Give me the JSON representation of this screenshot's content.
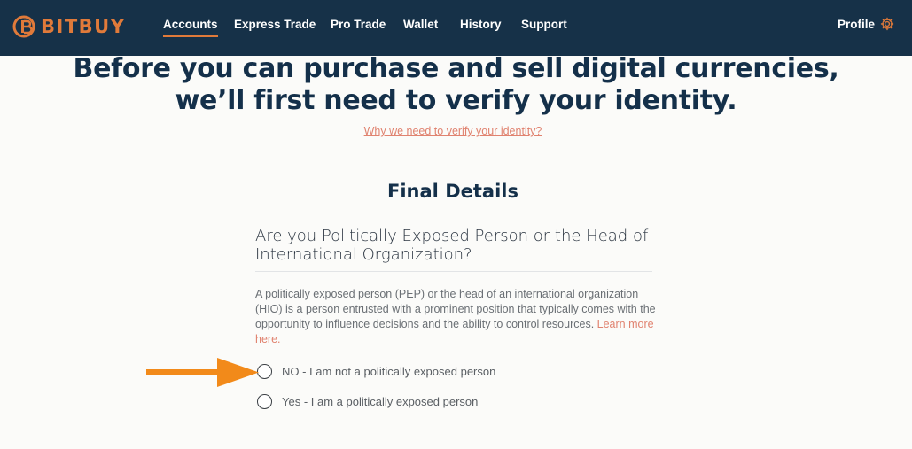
{
  "brand": {
    "name": "BITBUY",
    "accent": "#e07a3a",
    "nav_bg": "#163148"
  },
  "nav": {
    "items": [
      {
        "label": "Accounts",
        "active": true
      },
      {
        "label": "Express Trade"
      },
      {
        "label": "Pro Trade"
      },
      {
        "label": "Wallet"
      },
      {
        "label": "History"
      },
      {
        "label": "Support"
      }
    ],
    "profile_label": "Profile",
    "profile_icon": "gear-icon"
  },
  "headline": {
    "line1": "Before you can purchase and sell digital currencies,",
    "line2": "we’ll first need to verify your identity."
  },
  "why_link": "Why we need to verify your identity?",
  "section_title": "Final Details",
  "question": {
    "line1": "Are you Politically Exposed Person or the Head of",
    "line2": "International Organization?"
  },
  "description": {
    "text": "A politically exposed person (PEP) or the head of an international organization (HIO) is a person entrusted with a prominent position that typically comes with the opportunity to influence decisions and the ability to control resources.",
    "learn_more": "Learn more here."
  },
  "options": [
    {
      "label": "NO - I am not a politically exposed person",
      "selected": false
    },
    {
      "label": "Yes - I am a politically exposed person",
      "selected": false
    }
  ],
  "annotation": {
    "icon": "arrow-right-icon",
    "color": "#f28a1a"
  }
}
